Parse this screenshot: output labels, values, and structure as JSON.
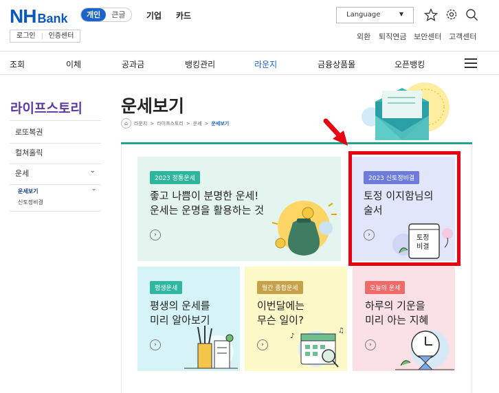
{
  "header": {
    "logo_nh": "NH",
    "logo_bank": "Bank",
    "segment": {
      "on": "개인",
      "off": "큰글"
    },
    "nav_top": [
      "기업",
      "카드"
    ],
    "login": "로그인",
    "cert": "인증센터",
    "language": "Language",
    "utility": [
      "외환",
      "퇴직연금",
      "보안센터",
      "고객센터"
    ],
    "icons": [
      "star-icon",
      "settings-icon",
      "search-icon"
    ]
  },
  "main_nav": {
    "items": [
      "조회",
      "이체",
      "공과금",
      "뱅킹관리",
      "라운지",
      "금융상품몰",
      "오픈뱅킹"
    ],
    "active_index": 4
  },
  "sidebar": {
    "title": "라이프스토리",
    "items": [
      "로또복권",
      "컬쳐홀릭",
      "운세"
    ],
    "sub_header": "운세보기",
    "sub_items": [
      "신토정비결"
    ]
  },
  "page": {
    "title": "운세보기",
    "breadcrumb": [
      "라운지",
      "라이프스토리",
      "운세"
    ],
    "breadcrumb_current": "운세보기"
  },
  "cards": {
    "card1": {
      "badge": "2023 정통운세",
      "text": "좋고 나쁨이 분명한 운세!\n운세는 운명을 활용하는 것"
    },
    "card2": {
      "badge": "2023 신토정비결",
      "text": "토정 이지함님의\n술서",
      "tablet": "토정\n비결"
    },
    "card3": {
      "badge": "평생운세",
      "text": "평생의 운세를\n미리 알아보기"
    },
    "card4": {
      "badge": "월간 종합운세",
      "text": "이번달에는\n무슨 일이?"
    },
    "card5": {
      "badge": "오늘의 운세",
      "text": "하루의 기운을\n미리 아는 지혜"
    },
    "go_glyph": "›"
  },
  "colors": {
    "brand": "#1b64c8",
    "teal": "#23a38e",
    "highlight": "#e60012"
  }
}
